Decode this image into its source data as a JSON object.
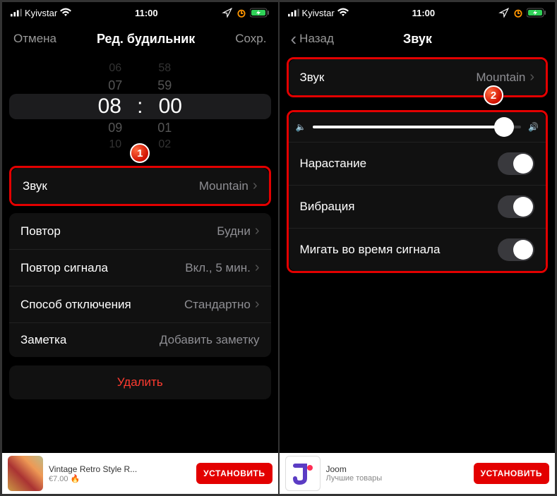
{
  "status": {
    "carrier": "Kyivstar",
    "time": "11:00"
  },
  "left": {
    "nav": {
      "cancel": "Отмена",
      "title": "Ред. будильник",
      "save": "Сохр."
    },
    "picker": {
      "r0h": "06",
      "r0m": "58",
      "r1h": "07",
      "r1m": "59",
      "selH": "08",
      "colon": ":",
      "selM": "00",
      "r3h": "09",
      "r3m": "01",
      "r4h": "10",
      "r4m": "02"
    },
    "sound": {
      "label": "Звук",
      "value": "Mountain"
    },
    "repeat": {
      "label": "Повтор",
      "value": "Будни"
    },
    "snooze": {
      "label": "Повтор сигнала",
      "value": "Вкл., 5 мин."
    },
    "dismiss": {
      "label": "Способ отключения",
      "value": "Стандартно"
    },
    "note": {
      "label": "Заметка",
      "placeholder": "Добавить заметку"
    },
    "delete": "Удалить",
    "badge": "1",
    "ad": {
      "title": "Vintage Retro Style R...",
      "price": "€7.00 🔥",
      "btn": "УСТАНОВИТЬ"
    }
  },
  "right": {
    "nav": {
      "back": "Назад",
      "title": "Звук"
    },
    "sound": {
      "label": "Звук",
      "value": "Mountain"
    },
    "volume_pct": 92,
    "fade": {
      "label": "Нарастание"
    },
    "vibrate": {
      "label": "Вибрация"
    },
    "flash": {
      "label": "Мигать во время сигнала"
    },
    "badge": "2",
    "ad": {
      "title": "Joom",
      "sub": "Лучшие товары",
      "btn": "УСТАНОВИТЬ"
    }
  }
}
